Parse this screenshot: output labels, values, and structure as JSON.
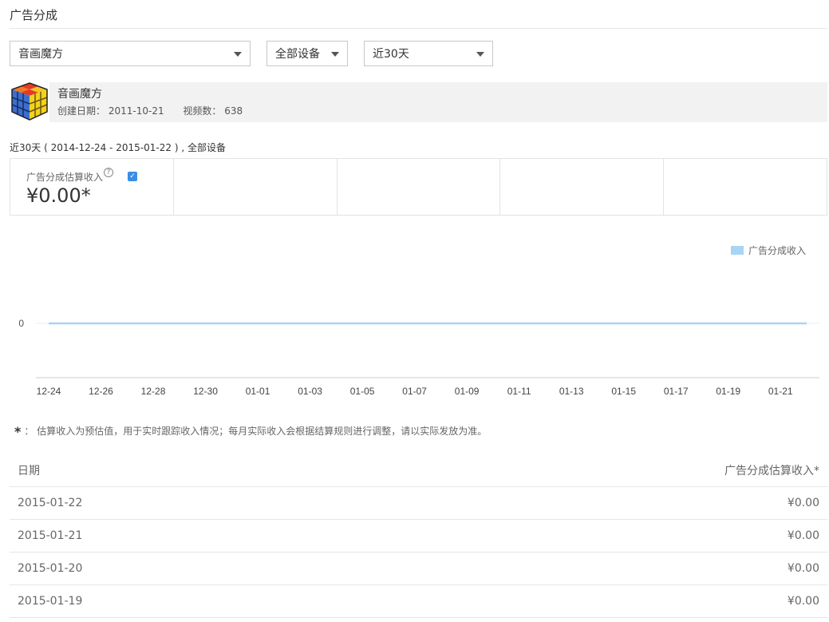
{
  "page": {
    "title": "广告分成"
  },
  "filters": {
    "app": "音画魔方",
    "device": "全部设备",
    "range": "近30天"
  },
  "app_card": {
    "name": "音画魔方",
    "created_label": "创建日期：",
    "created_value": "2011-10-21",
    "videos_label": "视频数：",
    "videos_value": "638"
  },
  "range_caption": "近30天 ( 2014-12-24 - 2015-01-22 ) , 全部设备",
  "metric": {
    "label": "广告分成估算收入",
    "value": "¥0.00*",
    "checked": true
  },
  "chart_data": {
    "type": "area",
    "x": [
      "12-24",
      "12-25",
      "12-26",
      "12-27",
      "12-28",
      "12-29",
      "12-30",
      "12-31",
      "01-01",
      "01-02",
      "01-03",
      "01-04",
      "01-05",
      "01-06",
      "01-07",
      "01-08",
      "01-09",
      "01-10",
      "01-11",
      "01-12",
      "01-13",
      "01-14",
      "01-15",
      "01-16",
      "01-17",
      "01-18",
      "01-19",
      "01-20",
      "01-21",
      "01-22"
    ],
    "tick_labels": [
      "12-24",
      "12-26",
      "12-28",
      "12-30",
      "01-01",
      "01-03",
      "01-05",
      "01-07",
      "01-09",
      "01-11",
      "01-13",
      "01-15",
      "01-17",
      "01-19",
      "01-21"
    ],
    "y_tick_labels": [
      "0"
    ],
    "series": [
      {
        "name": "广告分成收入",
        "color": "#a8d4f5",
        "values": [
          0,
          0,
          0,
          0,
          0,
          0,
          0,
          0,
          0,
          0,
          0,
          0,
          0,
          0,
          0,
          0,
          0,
          0,
          0,
          0,
          0,
          0,
          0,
          0,
          0,
          0,
          0,
          0,
          0,
          0
        ]
      }
    ],
    "legend_position": "top-right"
  },
  "footnote": "：  估算收入为预估值，用于实时跟踪收入情况；每月实际收入会根据结算规则进行调整，请以实际发放为准。",
  "table": {
    "headers": {
      "date": "日期",
      "revenue": "广告分成估算收入*"
    },
    "rows": [
      {
        "date": "2015-01-22",
        "revenue": "¥0.00"
      },
      {
        "date": "2015-01-21",
        "revenue": "¥0.00"
      },
      {
        "date": "2015-01-20",
        "revenue": "¥0.00"
      },
      {
        "date": "2015-01-19",
        "revenue": "¥0.00"
      }
    ]
  }
}
